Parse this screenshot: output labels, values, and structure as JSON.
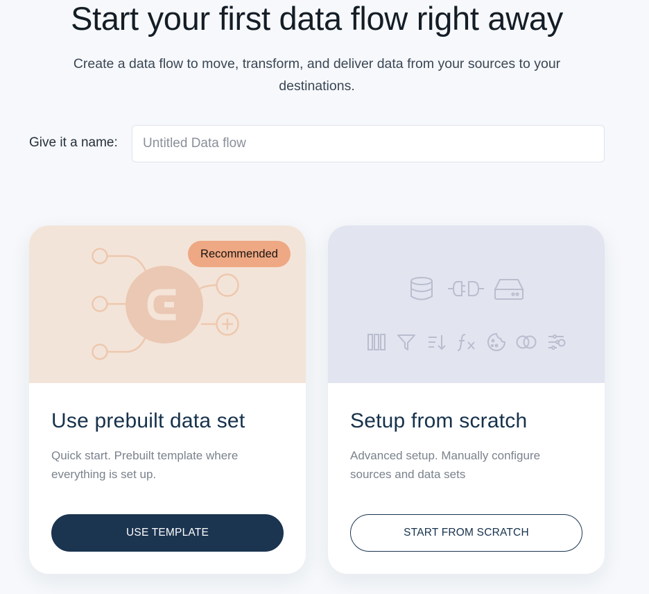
{
  "header": {
    "title": "Start your first data flow right away",
    "subtitle": "Create a data flow to move, transform, and deliver data from your sources to your destinations."
  },
  "name_field": {
    "label": "Give it a name:",
    "placeholder": "Untitled Data flow",
    "value": ""
  },
  "cards": [
    {
      "badge": "Recommended",
      "title": "Use prebuilt data set",
      "description": "Quick start. Prebuilt template where everything is set up.",
      "button_label": "USE TEMPLATE",
      "illustration_icons": [
        "node-network-icon",
        "brand-logo-icon",
        "plus-icon"
      ]
    },
    {
      "title": "Setup from scratch",
      "description": "Advanced setup. Manually configure sources and data sets",
      "button_label": "START FROM SCRATCH",
      "illustration_icons": [
        "database-icon",
        "connector-icon",
        "server-icon",
        "columns-icon",
        "filter-icon",
        "sort-icon",
        "function-icon",
        "cookie-icon",
        "merge-icon",
        "settings-sliders-icon"
      ]
    }
  ],
  "colors": {
    "background": "#f6f8fb",
    "primary_navy": "#1b3450",
    "card1_banner": "#f3e4d9",
    "card2_banner": "#e2e4f0",
    "badge": "#eea883",
    "illustration_peach": "#edc8ae",
    "illustration_lavender": "#b9bdce"
  }
}
